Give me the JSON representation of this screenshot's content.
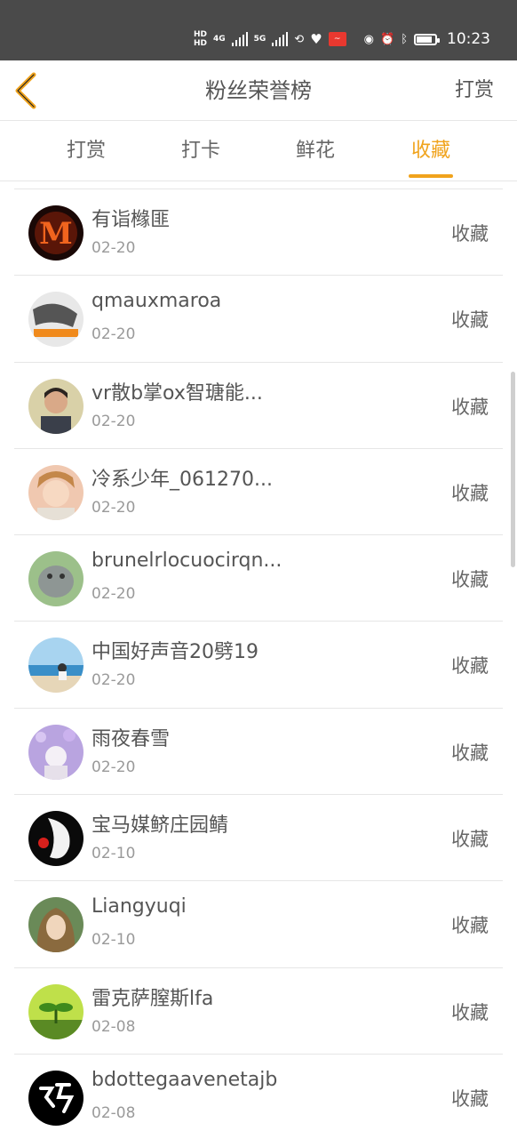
{
  "status_bar": {
    "hd1": "HD",
    "hd2": "HD",
    "net1": "4G",
    "net2": "5G",
    "time": "10:23"
  },
  "nav": {
    "title": "粉丝荣誉榜",
    "right": "打赏"
  },
  "tabs": [
    {
      "label": "打赏",
      "active": false
    },
    {
      "label": "打卡",
      "active": false
    },
    {
      "label": "鲜花",
      "active": false
    },
    {
      "label": "收藏",
      "active": true
    }
  ],
  "accent_color": "#f0a31c",
  "list": [
    {
      "name": "有诣橼匪",
      "date": "02-20",
      "action": "收藏"
    },
    {
      "name": "qmauxmaroa",
      "date": "02-20",
      "action": "收藏"
    },
    {
      "name": "vr散b掌ox智瑭能...",
      "date": "02-20",
      "action": "收藏"
    },
    {
      "name": "冷系少年_061270...",
      "date": "02-20",
      "action": "收藏"
    },
    {
      "name": "brunelrlocuocirqn...",
      "date": "02-20",
      "action": "收藏"
    },
    {
      "name": "中国好声音20劈19",
      "date": "02-20",
      "action": "收藏"
    },
    {
      "name": "雨夜春雪",
      "date": "02-20",
      "action": "收藏"
    },
    {
      "name": "宝马媒鲚庄园鲭",
      "date": "02-10",
      "action": "收藏"
    },
    {
      "name": "Liangyuqi",
      "date": "02-10",
      "action": "收藏"
    },
    {
      "name": "雷克萨膣斯lfa",
      "date": "02-08",
      "action": "收藏"
    },
    {
      "name": "bdottegaavenetajb",
      "date": "02-08",
      "action": "收藏"
    }
  ]
}
